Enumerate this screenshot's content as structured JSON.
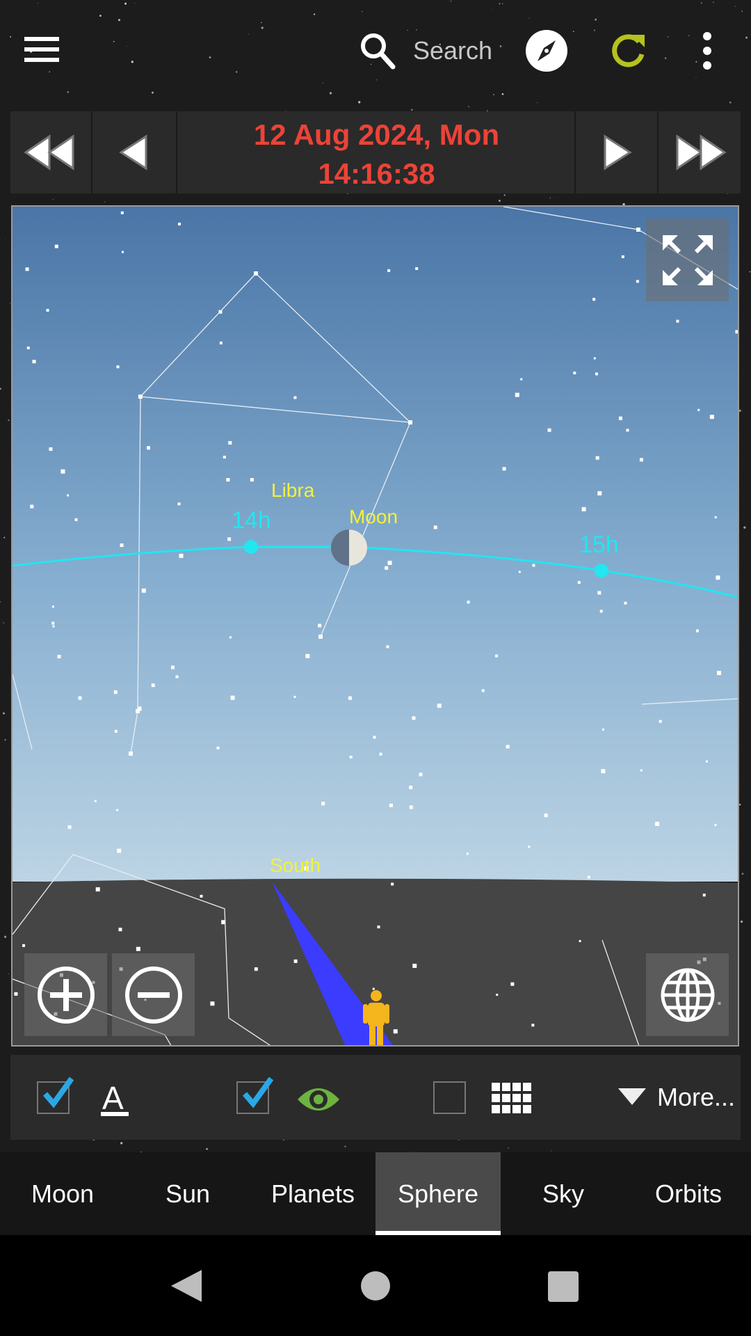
{
  "top_bar": {
    "menu_icon": "hamburger-menu-icon",
    "search_icon": "search-icon",
    "search_label": "Search",
    "compass_icon": "compass-icon",
    "refresh_icon": "refresh-icon",
    "refresh_color": "#b5c21e",
    "more_icon": "more-vertical-icon"
  },
  "date_bar": {
    "date": "12 Aug 2024,  Mon",
    "time": "14:16:38",
    "text_color": "#ec4338"
  },
  "sky_view": {
    "constellation_label": "Libra",
    "moon_label": "Moon",
    "hour_labels": [
      "14h",
      "15h"
    ],
    "direction_label": "South",
    "ecliptic_color": "#22e6f0",
    "label_color": "#f2f23a"
  },
  "toolbar": {
    "labels_checked": true,
    "visibility_checked": true,
    "grid_checked": false,
    "more_label": "More..."
  },
  "tabs": [
    {
      "label": "Moon",
      "active": false
    },
    {
      "label": "Sun",
      "active": false
    },
    {
      "label": "Planets",
      "active": false
    },
    {
      "label": "Sphere",
      "active": true
    },
    {
      "label": "Sky",
      "active": false
    },
    {
      "label": "Orbits",
      "active": false
    }
  ]
}
